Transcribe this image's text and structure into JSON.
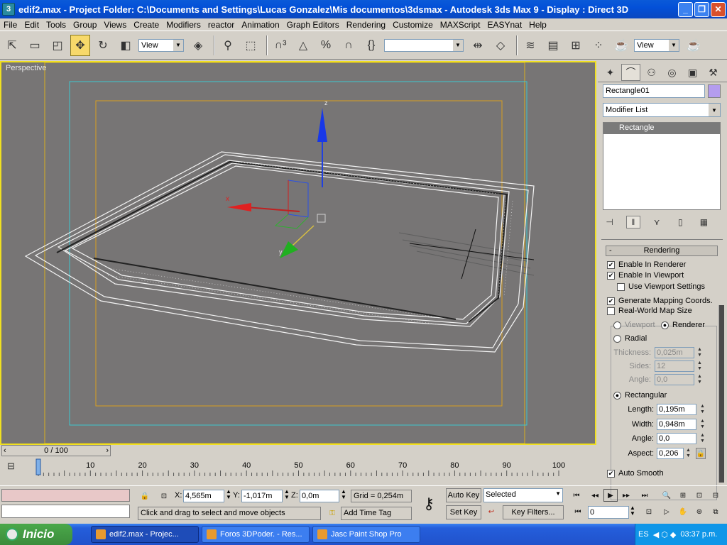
{
  "window": {
    "title": "edif2.max    - Project Folder: C:\\Documents and Settings\\Lucas Gonzalez\\Mis documentos\\3dsmax    - Autodesk 3ds Max 9    - Display : Direct 3D",
    "app_icon_label": "3",
    "minimize": "_",
    "maximize": "❐",
    "close": "✕"
  },
  "menu": [
    "File",
    "Edit",
    "Tools",
    "Group",
    "Views",
    "Create",
    "Modifiers",
    "reactor",
    "Animation",
    "Graph Editors",
    "Rendering",
    "Customize",
    "MAXScript",
    "EASYnat",
    "Help"
  ],
  "toolbar": {
    "ref_coord": "View",
    "named_selection": "",
    "render_view": "View",
    "icons": [
      "select-icon",
      "rect-region-icon",
      "window-crossing-icon",
      "move-icon",
      "rotate-icon",
      "scale-icon",
      "pivot-icon",
      "link-icon",
      "bind-icon",
      "snap3-icon",
      "angle-snap-icon",
      "percent-snap-icon",
      "spinner-snap-icon",
      "edit-named-sel-icon",
      "mirror-icon",
      "align-icon",
      "layer-icon",
      "curve-editor-icon",
      "schematic-icon",
      "material-editor-icon",
      "render-scene-icon",
      "quick-render-icon"
    ]
  },
  "viewport": {
    "label": "Perspective",
    "background": "#777575",
    "active_border": "#f0e020",
    "gizmo": {
      "x_label": "x",
      "z_label": "z",
      "y_label": "y"
    }
  },
  "command_panel": {
    "tabs": [
      "create-tab",
      "modify-tab",
      "hierarchy-tab",
      "motion-tab",
      "display-tab",
      "utilities-tab"
    ],
    "object_name": "Rectangle01",
    "object_color": "#b49cee",
    "modifier_list": "Modifier List",
    "stack_items": [
      "Rectangle"
    ],
    "rollout_title": "Rendering",
    "rollout_collapse": "-",
    "enable_in_renderer": {
      "label": "Enable In Renderer",
      "checked": true
    },
    "enable_in_viewport": {
      "label": "Enable In Viewport",
      "checked": true
    },
    "use_viewport_settings": {
      "label": "Use Viewport Settings",
      "checked": false
    },
    "generate_mapping": {
      "label": "Generate Mapping Coords.",
      "checked": true
    },
    "real_world_map": {
      "label": "Real-World Map Size",
      "checked": false
    },
    "radio_viewport": "Viewport",
    "radio_renderer": "Renderer",
    "radio_radial": "Radial",
    "thickness": {
      "label": "Thickness:",
      "value": "0,025m"
    },
    "sides": {
      "label": "Sides:",
      "value": "12"
    },
    "angle_radial": {
      "label": "Angle:",
      "value": "0,0"
    },
    "radio_rectangular": "Rectangular",
    "length": {
      "label": "Length:",
      "value": "0,195m"
    },
    "width": {
      "label": "Width:",
      "value": "0,948m"
    },
    "angle_rect": {
      "label": "Angle:",
      "value": "0,0"
    },
    "aspect": {
      "label": "Aspect:",
      "value": "0,206"
    },
    "auto_smooth": {
      "label": "Auto Smooth",
      "checked": true
    }
  },
  "timeline": {
    "slider": "0 / 100",
    "ticks": [
      "0",
      "10",
      "20",
      "30",
      "40",
      "50",
      "60",
      "70",
      "80",
      "90",
      "100"
    ]
  },
  "status": {
    "x_label": "X:",
    "x_value": "4,565m",
    "y_label": "Y:",
    "y_value": "-1,017m",
    "z_label": "Z:",
    "z_value": "0,0m",
    "grid": "Grid = 0,254m",
    "prompt": "Click and drag to select and move objects",
    "add_time_tag": "Add Time Tag",
    "auto_key": "Auto Key",
    "set_key": "Set Key",
    "key_mode": "Selected",
    "key_filters": "Key Filters...",
    "frame": "0"
  },
  "taskbar": {
    "start": "Inicio",
    "buttons": [
      "edif2.max     - Projec...",
      "Foros 3DPoder. - Res...",
      "Jasc Paint Shop Pro"
    ],
    "language": "ES",
    "clock": "03:37 p.m."
  }
}
